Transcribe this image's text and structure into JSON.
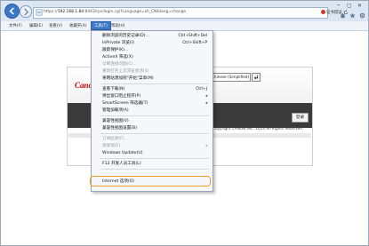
{
  "browser": {
    "url_prefix": "https://",
    "url_host": "192.168.1.84",
    "url_rest": ":8443/rps/login.cgi?Language=zh_CN&lang=change",
    "cert_label": "证书错误",
    "win_controls": [
      "✕",
      "▢",
      "─"
    ]
  },
  "menubar": {
    "items": [
      "文件(F)",
      "编辑(E)",
      "查看(V)",
      "收藏夹(A)",
      "工具(T)",
      "帮助(H)"
    ]
  },
  "tools_menu": {
    "items": [
      {
        "label": "删除浏览的历史记录(D)...",
        "shortcut": "Ctrl+Shift+Del",
        "disabled": false
      },
      {
        "label": "InPrivate 浏览(I)",
        "shortcut": "Ctrl+Shift+P",
        "disabled": false
      },
      {
        "label": "跟踪保护(K)...",
        "shortcut": "",
        "disabled": false
      },
      {
        "label": "ActiveX 筛选(X)",
        "shortcut": "",
        "disabled": false
      },
      {
        "label": "诊断连接问题(C)...",
        "shortcut": "",
        "disabled": true
      },
      {
        "label": "重新打开上次浏览会话(S)",
        "shortcut": "",
        "disabled": true
      },
      {
        "label": "将网站添加到\"开始\"菜单(M)",
        "shortcut": "",
        "disabled": false
      },
      {
        "label": "查看下载(N)",
        "shortcut": "Ctrl+J",
        "disabled": false
      },
      {
        "label": "弹出窗口阻止程序(P)",
        "shortcut": "",
        "arrow": true,
        "disabled": false
      },
      {
        "label": "SmartScreen 筛选器(T)",
        "shortcut": "",
        "arrow": true,
        "disabled": false
      },
      {
        "label": "管理加载项(A)",
        "shortcut": "",
        "disabled": false
      },
      {
        "label": "兼容性视图(V)",
        "shortcut": "",
        "disabled": false
      },
      {
        "label": "兼容性视图设置(B)",
        "shortcut": "",
        "disabled": false
      },
      {
        "label": "订阅此源(F)...",
        "shortcut": "",
        "disabled": true
      },
      {
        "label": "源发现(E)",
        "shortcut": "",
        "arrow": true,
        "disabled": true
      },
      {
        "label": "Windows Update(U)",
        "shortcut": "",
        "disabled": false
      },
      {
        "label": "F12 开发人员工具(L)",
        "shortcut": "",
        "disabled": false
      },
      {
        "label": "Internet 选项(O)",
        "shortcut": "",
        "disabled": false,
        "highlighted": true
      }
    ]
  },
  "page": {
    "logo": "Canon",
    "language_select": "Chinese (Simplified)",
    "login_button": "登录",
    "copyright": "Copyright CANON INC. 2013 All Rights Reserved"
  }
}
